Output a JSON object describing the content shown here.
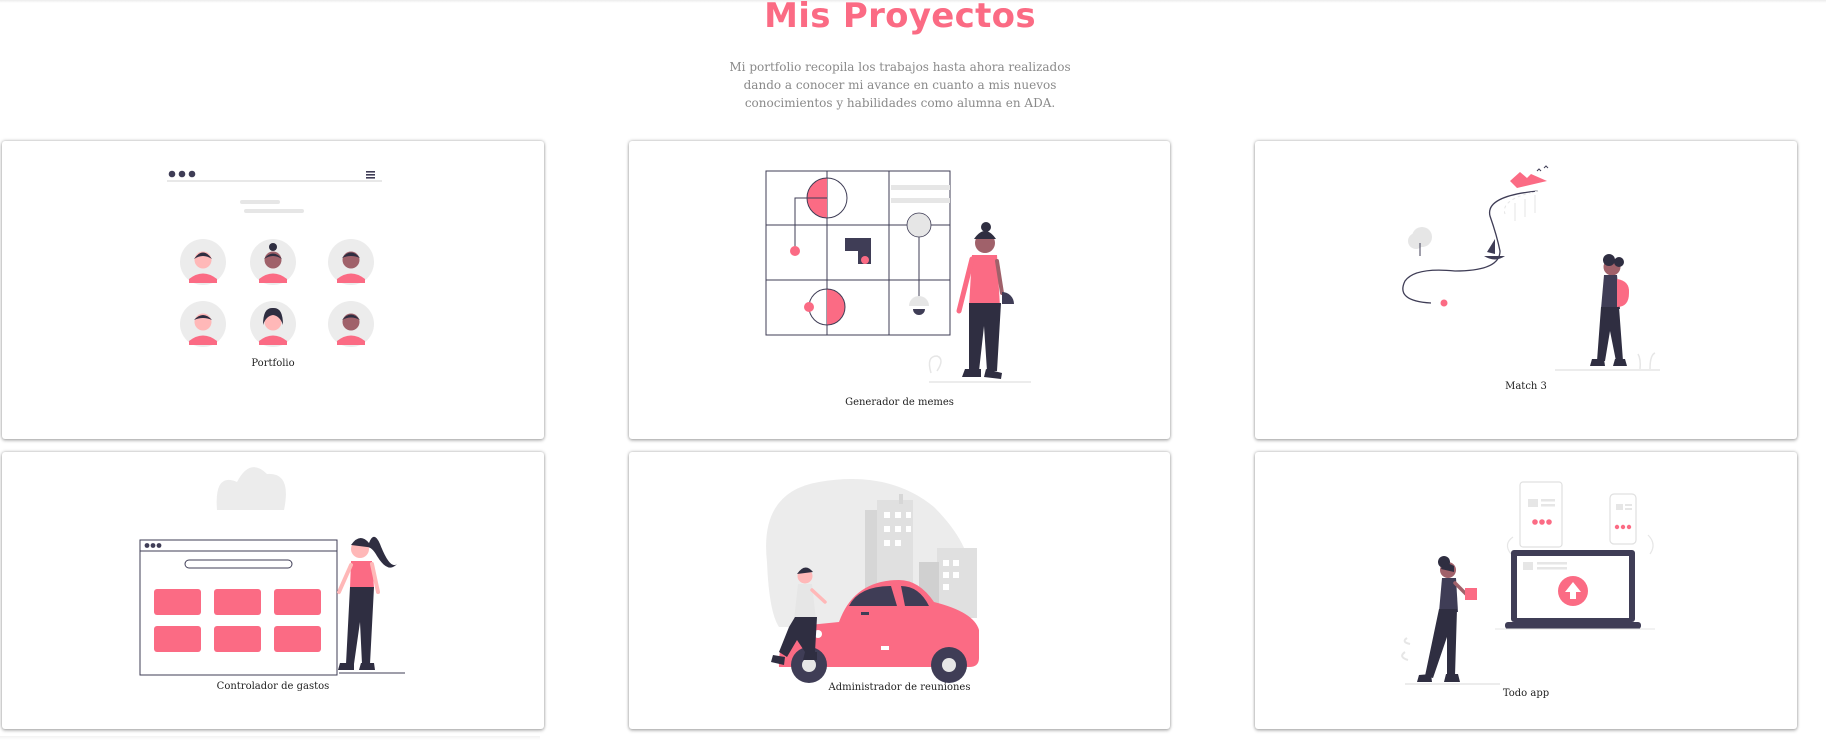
{
  "header": {
    "title": "Mis Proyectos",
    "intro": "Mi portfolio recopila los trabajos hasta ahora realizados dando a conocer mi avance en cuanto a mis nuevos conocimientos y habilidades como alumna en ADA."
  },
  "projects": [
    {
      "label": "Portfolio",
      "illustration": "team-avatars-illustration"
    },
    {
      "label": "Generador de memes",
      "illustration": "design-grid-illustration"
    },
    {
      "label": "Match 3",
      "illustration": "journey-path-illustration"
    },
    {
      "label": "Controlador de gastos",
      "illustration": "browser-cards-illustration"
    },
    {
      "label": "Administrador de reuniones",
      "illustration": "city-car-illustration"
    },
    {
      "label": "Todo app",
      "illustration": "laptop-upload-illustration"
    }
  ],
  "colors": {
    "accent": "#fb6b84",
    "dark": "#3f3d56",
    "light_gray": "#e6e6e6",
    "text_gray": "#8a8a8a"
  }
}
